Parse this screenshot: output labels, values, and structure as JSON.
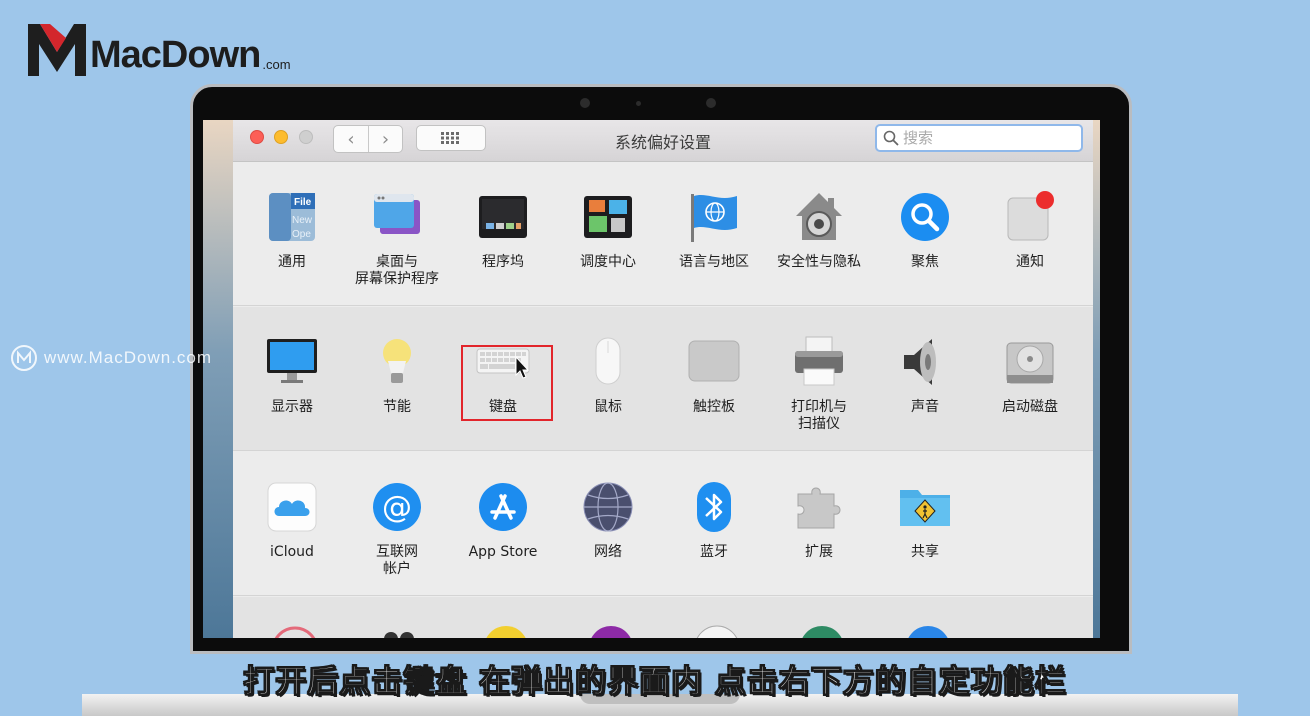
{
  "logo": {
    "text": "MacDown",
    "suffix": ".com"
  },
  "watermark": {
    "text": "www.MacDown.com"
  },
  "window": {
    "title": "系统偏好设置",
    "nav": {
      "back": "‹",
      "forward": "›"
    },
    "search_placeholder": "搜索"
  },
  "sections": [
    {
      "items": [
        {
          "id": "general",
          "label": "通用",
          "icon": "general-icon"
        },
        {
          "id": "desktop",
          "label": "桌面与\n屏幕保护程序",
          "icon": "desktop-screensaver-icon"
        },
        {
          "id": "dock",
          "label": "程序坞",
          "icon": "dock-icon"
        },
        {
          "id": "mission",
          "label": "调度中心",
          "icon": "mission-control-icon"
        },
        {
          "id": "language",
          "label": "语言与地区",
          "icon": "language-region-icon"
        },
        {
          "id": "security",
          "label": "安全性与隐私",
          "icon": "security-privacy-icon"
        },
        {
          "id": "spotlight",
          "label": "聚焦",
          "icon": "spotlight-icon"
        },
        {
          "id": "notifications",
          "label": "通知",
          "icon": "notifications-icon"
        }
      ]
    },
    {
      "items": [
        {
          "id": "displays",
          "label": "显示器",
          "icon": "display-icon"
        },
        {
          "id": "energy",
          "label": "节能",
          "icon": "energy-saver-icon"
        },
        {
          "id": "keyboard",
          "label": "键盘",
          "icon": "keyboard-icon"
        },
        {
          "id": "mouse",
          "label": "鼠标",
          "icon": "mouse-icon"
        },
        {
          "id": "trackpad",
          "label": "触控板",
          "icon": "trackpad-icon"
        },
        {
          "id": "printers",
          "label": "打印机与\n扫描仪",
          "icon": "printer-scanner-icon"
        },
        {
          "id": "sound",
          "label": "声音",
          "icon": "sound-icon"
        },
        {
          "id": "startup",
          "label": "启动磁盘",
          "icon": "startup-disk-icon"
        }
      ]
    },
    {
      "items": [
        {
          "id": "icloud",
          "label": "iCloud",
          "icon": "icloud-icon"
        },
        {
          "id": "internet",
          "label": "互联网\n帐户",
          "icon": "internet-accounts-icon"
        },
        {
          "id": "appstore",
          "label": "App Store",
          "icon": "app-store-icon"
        },
        {
          "id": "network",
          "label": "网络",
          "icon": "network-icon"
        },
        {
          "id": "bluetooth",
          "label": "蓝牙",
          "icon": "bluetooth-icon"
        },
        {
          "id": "extensions",
          "label": "扩展",
          "icon": "extensions-icon"
        },
        {
          "id": "sharing",
          "label": "共享",
          "icon": "sharing-icon"
        }
      ]
    }
  ],
  "colors": {
    "highlight": "#e2252b",
    "background": "#9ec6ea"
  },
  "subtitle": "打开后点击键盘 在弹出的界面内 点击右下方的自定功能栏"
}
